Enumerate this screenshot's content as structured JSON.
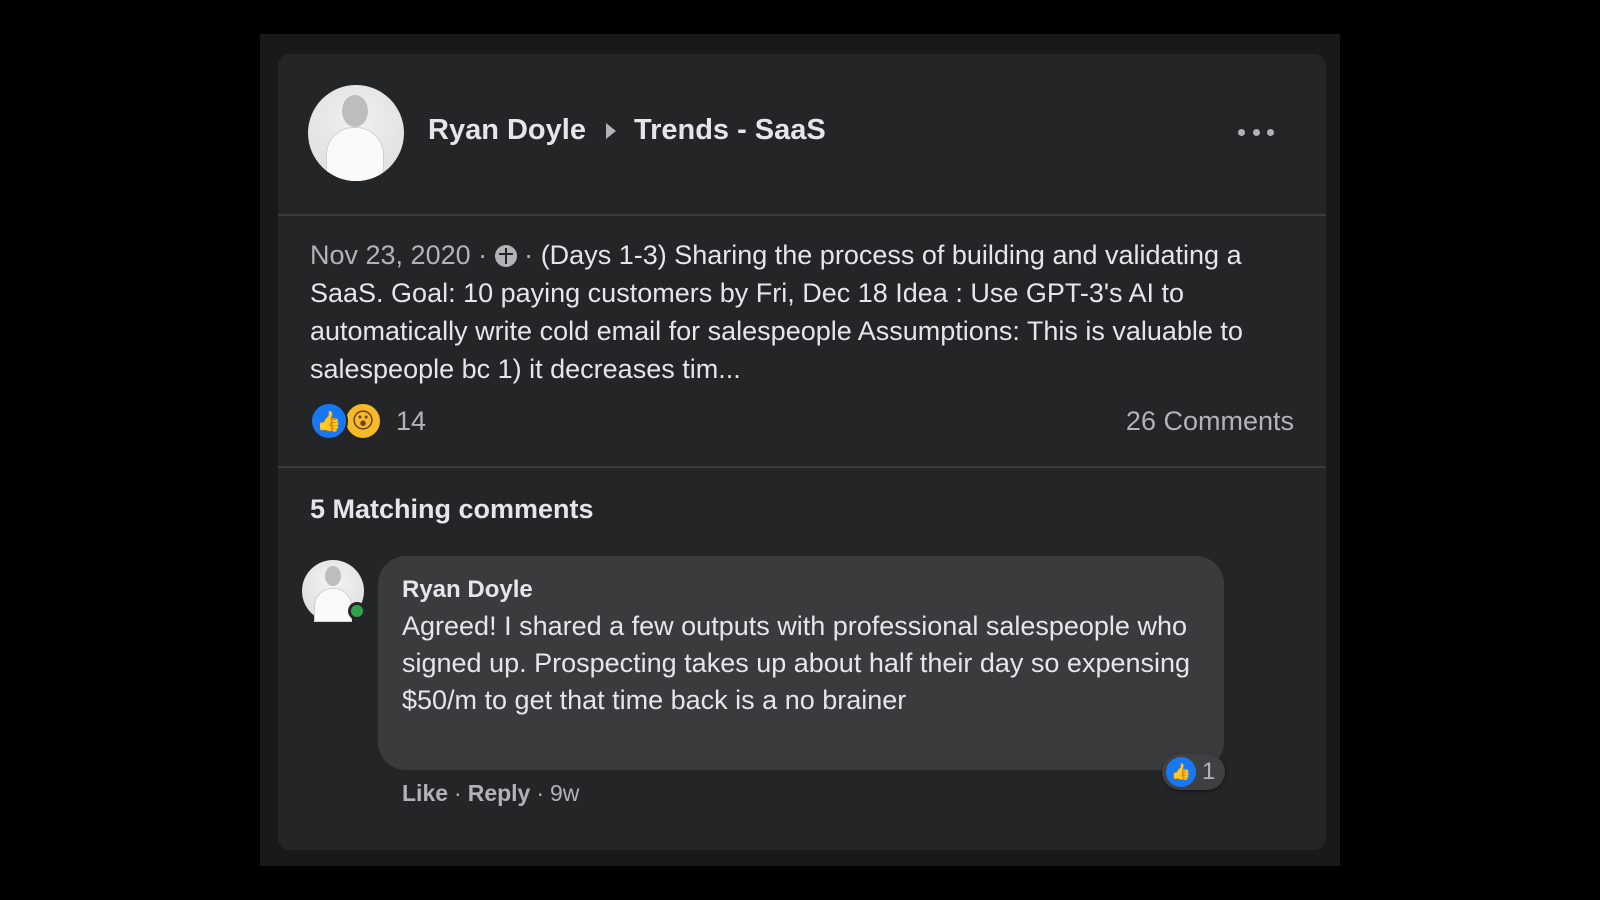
{
  "post": {
    "author": "Ryan Doyle",
    "group": "Trends - SaaS",
    "date": "Nov 23, 2020",
    "meta_sep": "·",
    "privacy_icon": "globe-icon",
    "text": "(Days 1-3) Sharing the process of building and validating a SaaS. Goal: 10 paying customers by Fri, Dec 18 Idea : Use GPT-3's AI to automatically write cold email for salespeople Assumptions: This is valuable to salespeople bc 1) it decreases tim...",
    "reactions": {
      "icons": [
        "like-reaction-icon",
        "wow-reaction-icon"
      ],
      "count": "14"
    },
    "comments_count": "26 Comments"
  },
  "matching": {
    "title": "5 Matching comments"
  },
  "comment": {
    "author": "Ryan Doyle",
    "text": "Agreed! I shared a few outputs with professional salespeople who signed up. Prospecting takes up about half their day so expensing $50/m to get that time back is a no brainer",
    "reaction_count": "1",
    "actions": {
      "like": "Like",
      "reply": "Reply",
      "time": "9w",
      "sep": "·"
    }
  },
  "colors": {
    "background": "#000000",
    "card": "#242526",
    "bubble": "#3a3b3c",
    "text_primary": "#e4e6eb",
    "text_secondary": "#b0b3b8",
    "like_blue": "#1877f2",
    "wow_yellow": "#f7b928",
    "online_green": "#31a24c"
  }
}
